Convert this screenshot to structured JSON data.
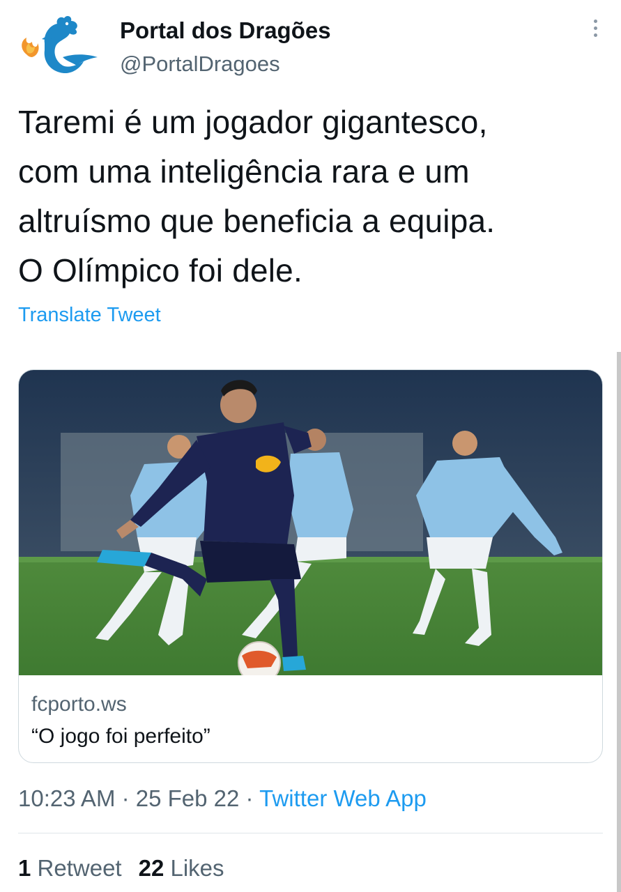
{
  "author": {
    "display_name": "Portal dos Dragões",
    "handle": "@PortalDragoes",
    "avatar_icon": "blue-dragon-logo"
  },
  "more_icon": "vertical-ellipsis-icon",
  "tweet": {
    "lines": [
      "Taremi é um jogador gigantesco,",
      "com uma inteligência rara e um",
      "altruísmo que beneficia a equipa.",
      "O Olímpico foi dele."
    ],
    "translate_label": "Translate Tweet"
  },
  "card": {
    "image_description_icon": "footballer-taking-penalty-photo",
    "domain": "fcporto.ws",
    "title": "“O jogo foi perfeito”"
  },
  "meta": {
    "time": "10:23 AM",
    "sep1": " · ",
    "date": "25 Feb 22",
    "sep2": " · ",
    "app": "Twitter Web App"
  },
  "stats": {
    "retweets_count": "1",
    "retweets_label": " Retweet",
    "likes_count": "22",
    "likes_label": " Likes"
  },
  "colors": {
    "link": "#1d9bf0",
    "secondary_text": "#536471",
    "primary_text": "#0f1419",
    "avatar_blue": "#1e88c8"
  }
}
